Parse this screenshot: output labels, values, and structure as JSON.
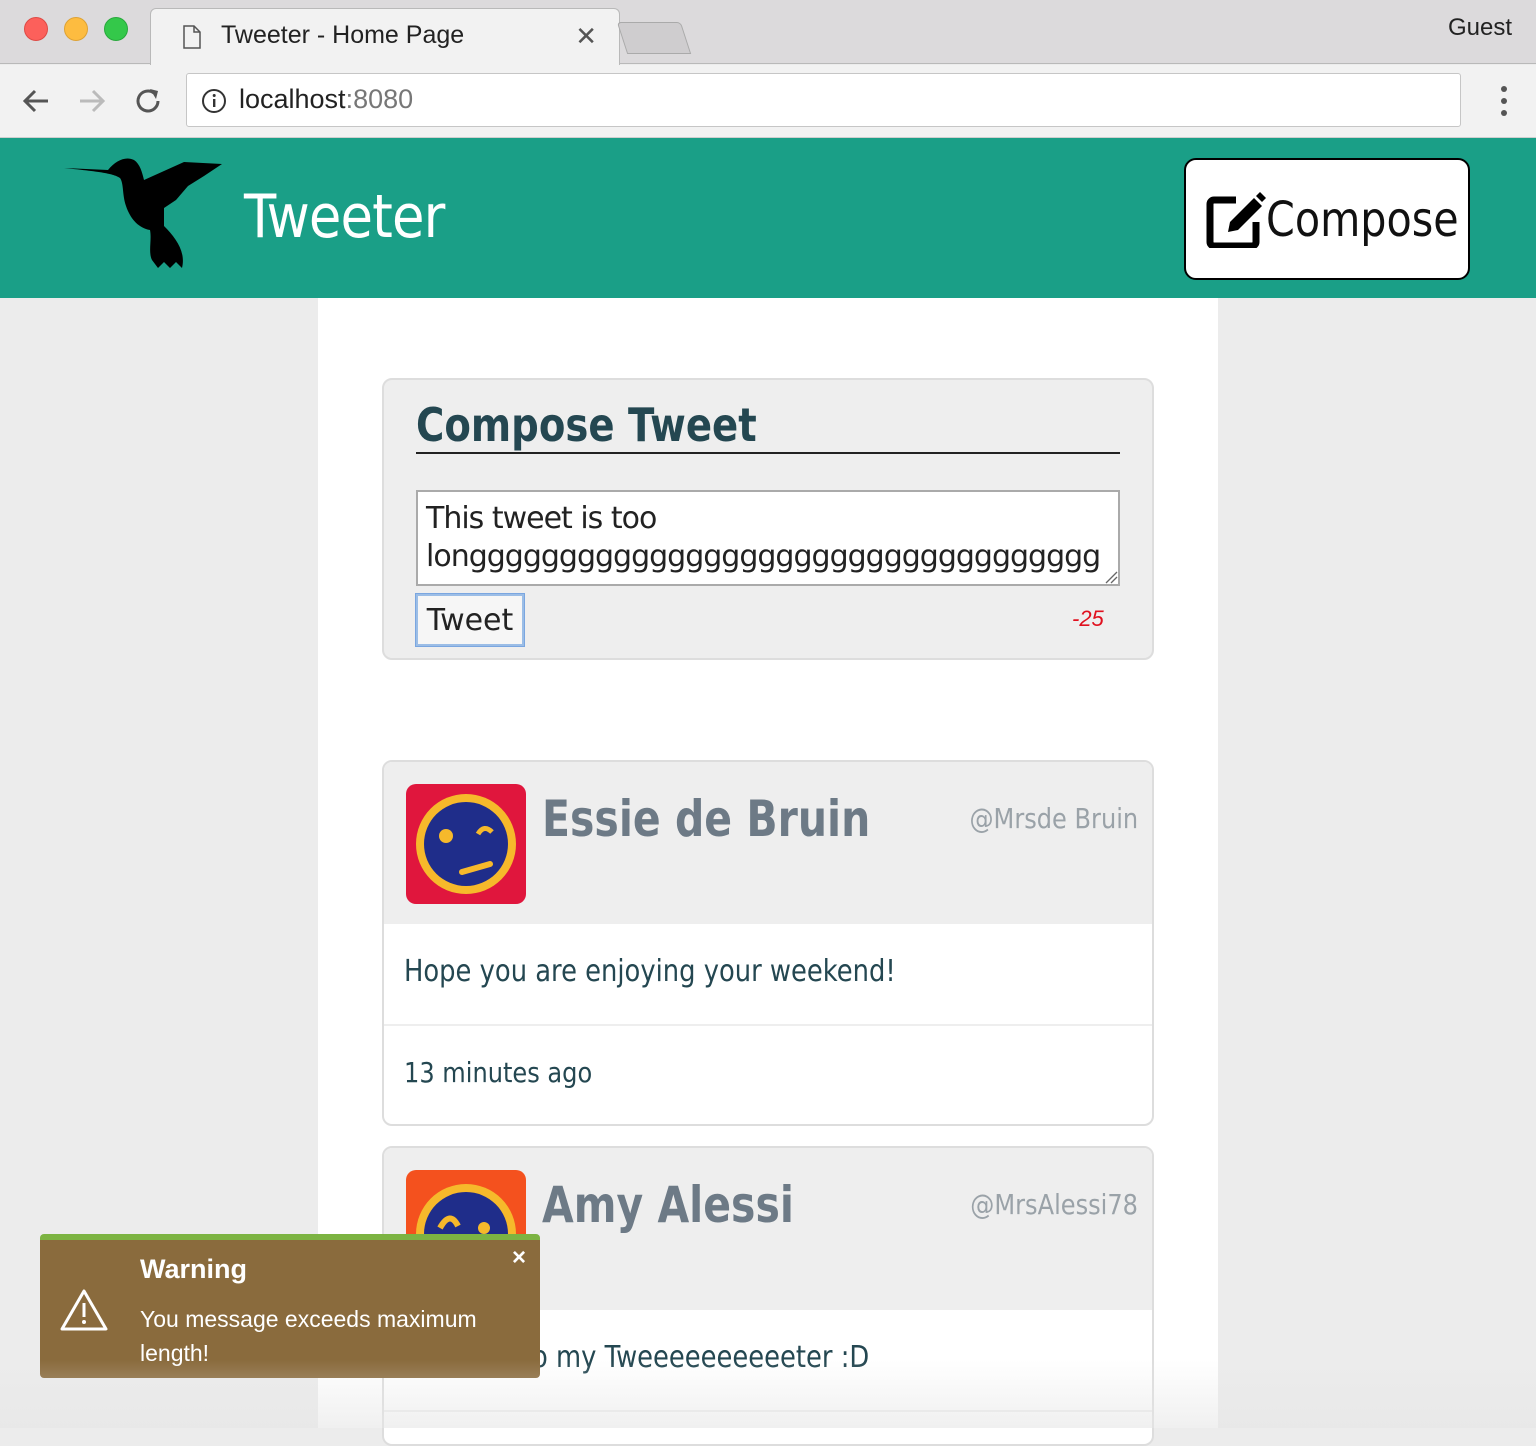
{
  "browser": {
    "tab_title": "Tweeter - Home Page",
    "profile_label": "Guest",
    "url_host": "localhost",
    "url_port": ":8080"
  },
  "nav": {
    "brand": "Tweeter",
    "compose_label": "Compose",
    "brand_color": "#1a9f87"
  },
  "compose": {
    "title": "Compose Tweet",
    "textarea_value": "This tweet is too longgggggggggggggggggggggggggggggggggggggggg",
    "button_label": "Tweet",
    "counter": "-25"
  },
  "tweets": [
    {
      "name": "Essie de Bruin",
      "handle": "@Mrsde Bruin",
      "text": "Hope you are enjoying your weekend!",
      "time": "13 minutes ago",
      "avatar_color": "#e0163d"
    },
    {
      "name": "Amy Alessi",
      "handle": "@MrsAlessi78",
      "text": "o my Tweeeeeeeeeeter :D",
      "avatar_color": "#f4511e"
    }
  ],
  "toast": {
    "title": "Warning",
    "message": "You message exceeds maximum length!",
    "close": "×"
  }
}
